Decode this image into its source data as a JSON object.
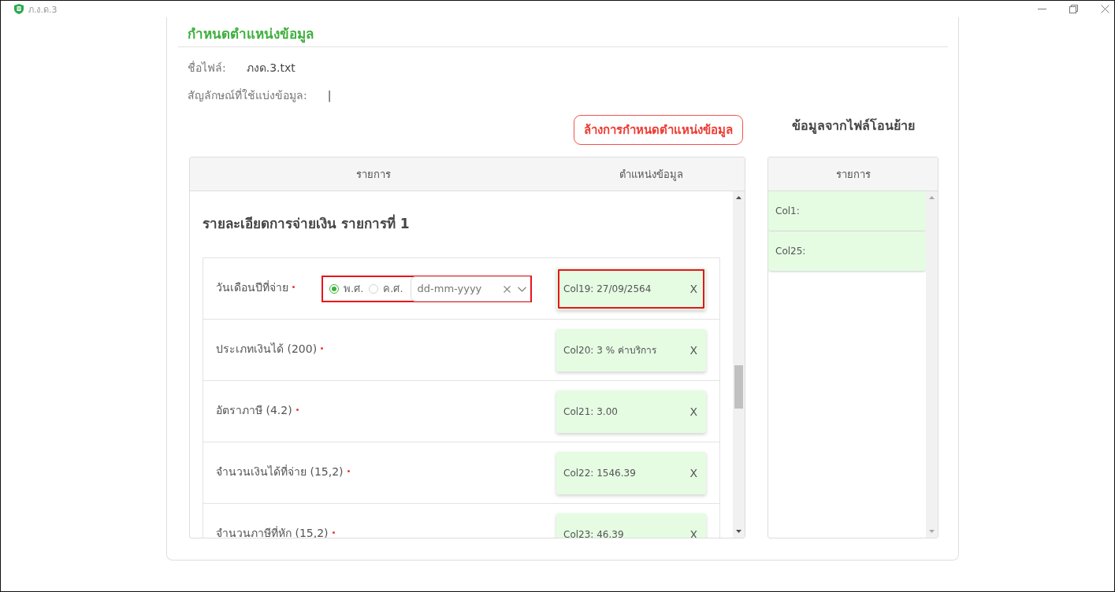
{
  "window": {
    "title": "ภ.ง.ด.3"
  },
  "page": {
    "title": "กำหนดตำแหน่งข้อมูล",
    "fields": [
      {
        "label": "ชื่อไฟล์:",
        "value": "ภงด.3.txt"
      },
      {
        "label": "สัญลักษณ์ที่ใช้แบ่งข้อมูล:",
        "value": "|"
      }
    ]
  },
  "clear_button": {
    "label": "ล้างการกำหนดตำแหน่งข้อมูล"
  },
  "mapping_table": {
    "columns": [
      "รายการ",
      "ตำแหน่งข้อมูล"
    ],
    "section_title": "รายละเอียดการจ่ายเงิน รายการที่ 1",
    "rows": [
      {
        "kind": "date",
        "label": "วันเดือนปีที่จ่าย",
        "required": true,
        "era_options": [
          {
            "label": "พ.ศ.",
            "selected": true
          },
          {
            "label": "ค.ศ.",
            "selected": false
          }
        ],
        "date_field": {
          "placeholder": "dd-mm-yyyy",
          "highlighted": true
        },
        "mapping": {
          "text": "Col19: 27/09/2564",
          "remove_label": "X",
          "highlighted": true
        }
      },
      {
        "kind": "plain",
        "label": "ประเภทเงินได้ (200)",
        "required": true,
        "mapping": {
          "text": "Col20: 3 % ค่าบริการ",
          "remove_label": "X",
          "highlighted": false
        }
      },
      {
        "kind": "plain",
        "label": "อัตราภาษี (4.2)",
        "required": true,
        "mapping": {
          "text": "Col21: 3.00",
          "remove_label": "X",
          "highlighted": false
        }
      },
      {
        "kind": "plain",
        "label": "จำนวนเงินได้ที่จ่าย (15,2)",
        "required": true,
        "mapping": {
          "text": "Col22: 1546.39",
          "remove_label": "X",
          "highlighted": false
        }
      },
      {
        "kind": "plain",
        "label": "จำนวนภาษีที่หัก (15,2)",
        "required": true,
        "mapping": {
          "text": "Col23: 46.39",
          "remove_label": "X",
          "highlighted": false
        }
      }
    ]
  },
  "source_panel": {
    "title": "ข้อมูลจากไฟล์โอนย้าย",
    "columns": [
      "รายการ"
    ],
    "items": [
      {
        "text": "Col1:"
      },
      {
        "text": "Col25:"
      }
    ]
  }
}
